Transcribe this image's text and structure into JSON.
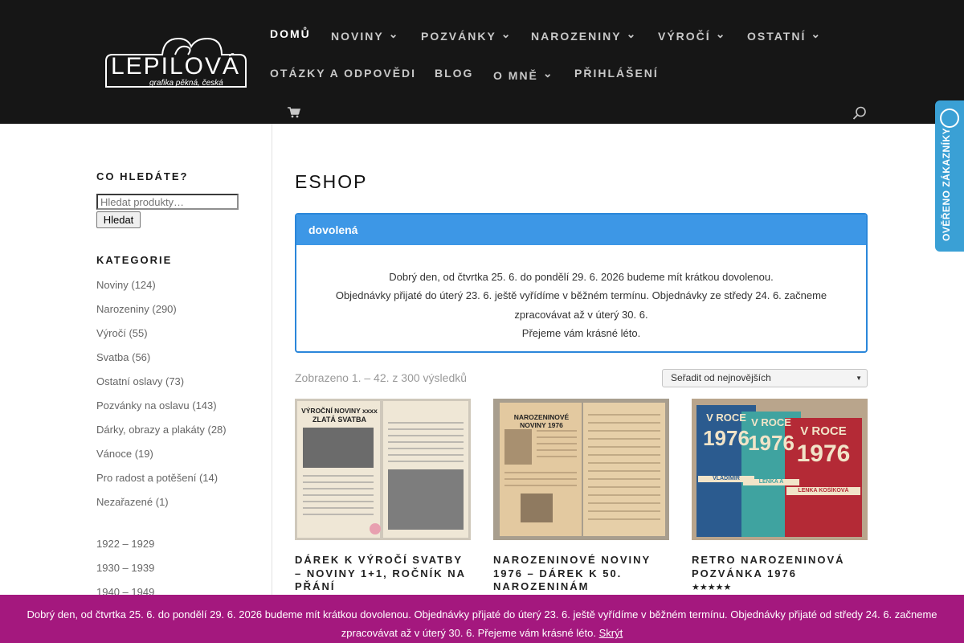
{
  "logo": {
    "main": "LEPILOVÁ",
    "sub": "grafika pěkná, česká"
  },
  "nav": {
    "items": [
      {
        "label": "DOMŮ",
        "chevron": false,
        "active": true
      },
      {
        "label": "NOVINY",
        "chevron": true
      },
      {
        "label": "POZVÁNKY",
        "chevron": true
      },
      {
        "label": "NAROZENINY",
        "chevron": true
      },
      {
        "label": "VÝROČÍ",
        "chevron": true
      },
      {
        "label": "OSTATNÍ",
        "chevron": true
      },
      {
        "label": "OTÁZKY A ODPOVĚDI",
        "chevron": false
      },
      {
        "label": "BLOG",
        "chevron": false
      },
      {
        "label": "O MNĚ",
        "chevron": true
      },
      {
        "label": "PŘIHLÁŠENÍ",
        "chevron": false
      }
    ],
    "chevron_glyph": "3",
    "cart_icon": "cart-icon",
    "search_icon": "search-icon"
  },
  "badge": {
    "text": "OVĚŘENO ZÁKAZNÍKY",
    "color": "#3aa0d5"
  },
  "sidebar": {
    "search_title": "CO HLEDÁTE?",
    "search_placeholder": "Hledat produkty…",
    "search_button": "Hledat",
    "categories_title": "KATEGORIE",
    "categories": [
      {
        "name": "Noviny",
        "count": "(124)"
      },
      {
        "name": "Narozeniny",
        "count": "(290)"
      },
      {
        "name": "Výročí",
        "count": "(55)"
      },
      {
        "name": "Svatba",
        "count": "(56)"
      },
      {
        "name": "Ostatní oslavy",
        "count": "(73)"
      },
      {
        "name": "Pozvánky na oslavu",
        "count": "(143)"
      },
      {
        "name": "Dárky, obrazy a plakáty",
        "count": "(28)"
      },
      {
        "name": "Vánoce",
        "count": "(19)"
      },
      {
        "name": "Pro radost a potěšení",
        "count": "(14)"
      },
      {
        "name": "Nezařazené",
        "count": "(1)"
      }
    ],
    "years": [
      "1922 – 1929",
      "1930 – 1939",
      "1940 – 1949"
    ]
  },
  "main": {
    "title": "ESHOP",
    "notice": {
      "heading": "dovolená",
      "lines": [
        "Dobrý den, od čtvrtka 25. 6. do pondělí 29. 6. 2026 budeme mít krátkou dovolenou.",
        "Objednávky přijaté do úterý 23. 6. ještě vyřídíme v běžném termínu. Objednávky ze středy 24. 6. začneme",
        "zpracovávat až v úterý 30. 6.",
        "Přejeme vám krásné léto."
      ],
      "border_color": "#2b87da",
      "header_color": "#3d97e6"
    },
    "result_count": "Zobrazeno 1. – 42. z 300 výsledků",
    "sort_selected": "Seřadit od nejnovějších",
    "products": [
      {
        "title": "DÁREK K VÝROČÍ SVATBY – NOVINY 1+1, ROČNÍK NA PŘÁNÍ",
        "img_heading": "VÝROČNÍ NOVINY xxxx",
        "img_sub": "ZLATÁ SVATBA",
        "stars": ""
      },
      {
        "title": "NAROZENINOVÉ NOVINY 1976 – DÁREK K 50. NAROZENINÁM",
        "img_heading": "NAROZENINOVÉ NOVINY 1976",
        "img_sub": "",
        "stars": ""
      },
      {
        "title": "RETRO NAROZENINOVÁ POZVÁNKA 1976",
        "img_heading": "V ROCE",
        "img_sub": "1976",
        "img_names": [
          "VLADIMÍR",
          "LENKA A",
          "LENKA KOŠÍKOVÁ"
        ],
        "stars": "★★★★★"
      }
    ]
  },
  "store_bar": {
    "text": "Dobrý den, od čtvrtka 25. 6. do pondělí 29. 6. 2026 budeme mít krátkou dovolenou. Objednávky přijaté do úterý 23. 6. ještě vyřídíme v běžném termínu. Objednávky přijaté od středy 24. 6. začneme zpracovávat až v úterý 30. 6. Přejeme vám krásné léto.",
    "hide_label": "Skrýt",
    "color": "#a4187e"
  }
}
